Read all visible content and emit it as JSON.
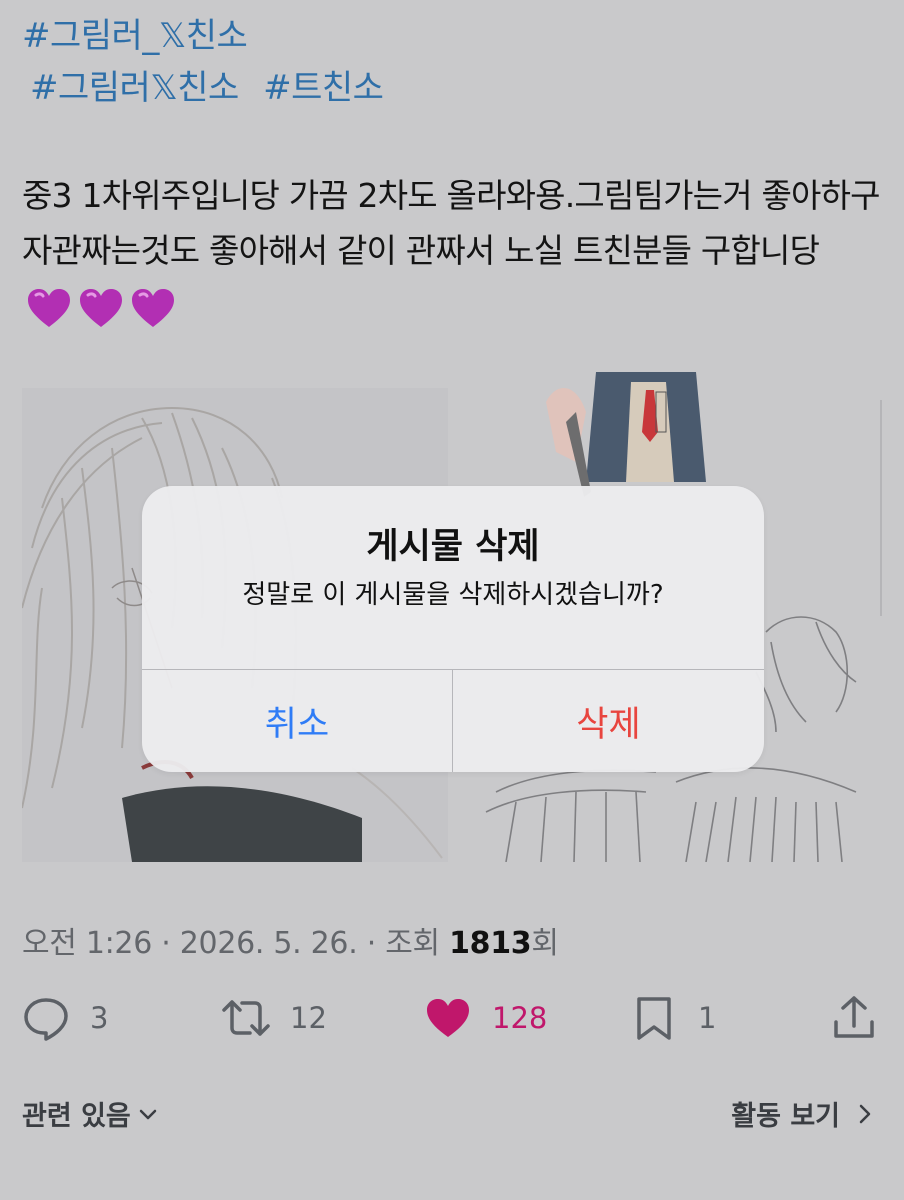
{
  "hashtags_line1": [
    "#그림러_𝕏친소"
  ],
  "hashtags_line2": [
    "#그림러𝕏친소",
    "#트친소"
  ],
  "post_text": "중3 1차위주입니당 가끔 2차도 올라와용.그림팀가는거 좋아하구 자관짜는것도 좋아해서 같이 관짜서 노실 트친분들 구합니당",
  "emoji": [
    "purple-heart",
    "purple-heart",
    "purple-heart"
  ],
  "dialog": {
    "title": "게시물 삭제",
    "message": "정말로 이 게시물을 삭제하시겠습니까?",
    "cancel_label": "취소",
    "delete_label": "삭제"
  },
  "meta": {
    "time": "오전 1:26",
    "date": "2026. 5. 26.",
    "views_label": "조회",
    "views_count": "1813",
    "views_suffix": "회",
    "separator": "·"
  },
  "actions": {
    "reply_count": "3",
    "retweet_count": "12",
    "like_count": "128",
    "bookmark_count": "1"
  },
  "footer": {
    "related_label": "관련 있음",
    "activity_label": "활동 보기"
  },
  "colors": {
    "hashtag": "#2f6fa8",
    "like": "#c0176b",
    "cancel": "#2f7cf6",
    "delete": "#e8453f"
  }
}
